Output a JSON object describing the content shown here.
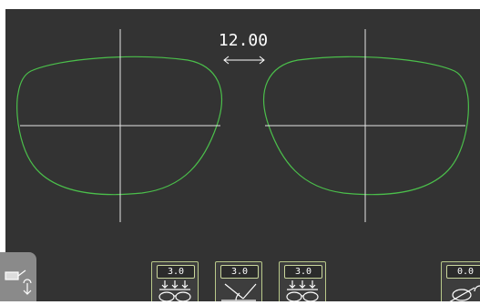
{
  "frame_measurement": {
    "dbl_value": "12.00",
    "arrow_icon": "double-arrow-icon"
  },
  "toolbar": {
    "tools": [
      {
        "value": "3.0",
        "icon": "three-drill-points-icon"
      },
      {
        "value": "3.0",
        "icon": "bevel-angle-icon"
      },
      {
        "value": "3.0",
        "icon": "three-drill-points-icon"
      },
      {
        "value": "0.0",
        "icon": "lens-rotate-icon"
      }
    ],
    "side_icon": "tracer-probe-icon"
  },
  "colors": {
    "background": "#333333",
    "lens_outline": "#4bbf4b",
    "crosshair": "#e6e6e6",
    "tool_border": "#b9c98a"
  }
}
